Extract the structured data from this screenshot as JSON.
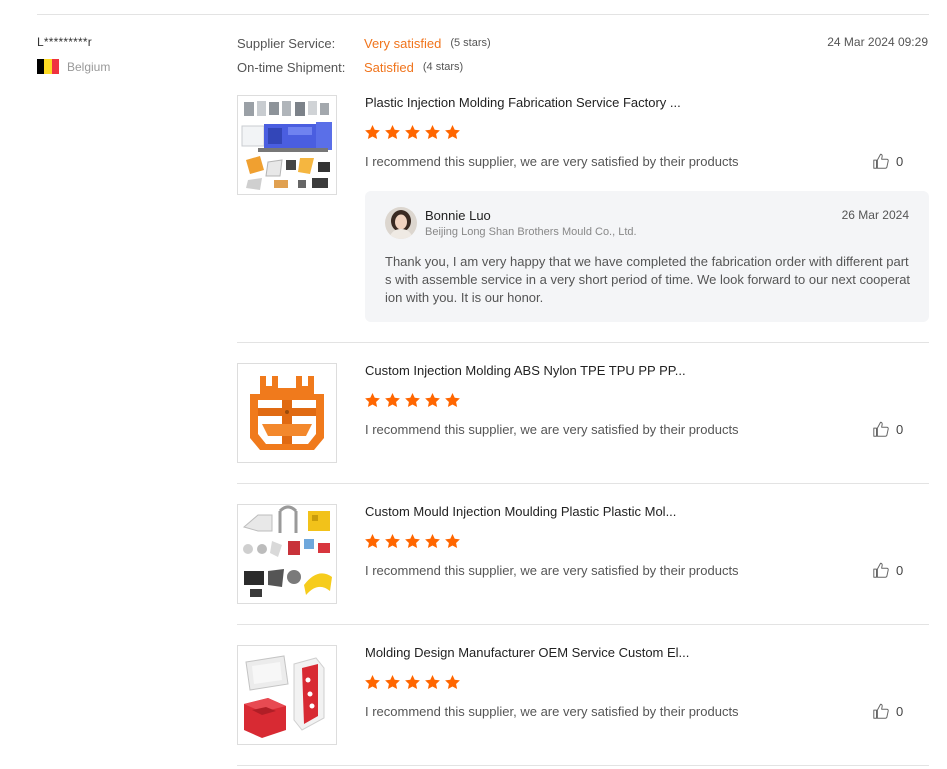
{
  "review": {
    "reviewer_name": "L*********r",
    "country": "Belgium",
    "flag_colors": [
      "#000000",
      "#fdda24",
      "#ef3340"
    ],
    "date": "24 Mar 2024 09:29",
    "ratings": [
      {
        "label": "Supplier Service:",
        "value": "Very satisfied",
        "stars": "(5 stars)"
      },
      {
        "label": "On-time Shipment:",
        "value": "Satisfied",
        "stars": "(4 stars)"
      }
    ]
  },
  "products": [
    {
      "title": "Plastic Injection Molding Fabrication Service Factory ...",
      "rating": 5,
      "comment": "I recommend this supplier, we are very satisfied by their products",
      "likes": "0",
      "thumb_icon": "injection-machine-parts-image"
    },
    {
      "title": "Custom Injection Molding ABS Nylon TPE TPU PP PP...",
      "rating": 5,
      "comment": "I recommend this supplier, we are very satisfied by their products",
      "likes": "0",
      "thumb_icon": "orange-bracket-image"
    },
    {
      "title": "Custom Mould Injection Moulding Plastic Plastic Mol...",
      "rating": 5,
      "comment": "I recommend this supplier, we are very satisfied by their products",
      "likes": "0",
      "thumb_icon": "assorted-plastic-parts-image"
    },
    {
      "title": "Molding Design Manufacturer OEM Service Custom El...",
      "rating": 5,
      "comment": "I recommend this supplier, we are very satisfied by their products",
      "likes": "0",
      "thumb_icon": "red-white-enclosure-image"
    }
  ],
  "reply": {
    "name": "Bonnie Luo",
    "company": "Beijing Long Shan Brothers Mould Co., Ltd.",
    "date": "26 Mar 2024",
    "text": "Thank you, I am very happy that we have completed the fabrication order  with different parts with assemble service in a very short period of time. We look forward to our next cooperation with you. It is our honor."
  },
  "colors": {
    "accent": "#f0741c",
    "star": "#ff6600",
    "divider": "#e3e3e3",
    "reply_bg": "#f4f5f7"
  }
}
